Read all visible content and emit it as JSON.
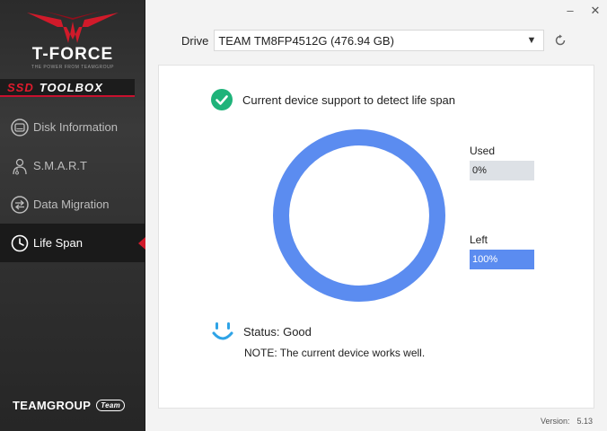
{
  "brand": {
    "title": "T-FORCE",
    "tagline": "THE POWER FROM TEAMGROUP",
    "toolbox_prefix": "SSD",
    "toolbox_suffix": "TOOLBOX",
    "footer_logo": "TEAMGROUP",
    "footer_badge": "Team"
  },
  "sidebar": {
    "items": [
      {
        "label": "Disk Information",
        "icon": "disk-icon",
        "active": false
      },
      {
        "label": "S.M.A.R.T",
        "icon": "doctor-icon",
        "active": false
      },
      {
        "label": "Data Migration",
        "icon": "migration-icon",
        "active": false
      },
      {
        "label": "Life Span",
        "icon": "clock-icon",
        "active": true
      }
    ]
  },
  "window": {
    "minimize": "–",
    "close": "✕"
  },
  "drive": {
    "label": "Drive",
    "selected": "TEAM TM8FP4512G (476.94 GB)"
  },
  "life_span": {
    "support_text": "Current device support to detect life span",
    "used_label": "Used",
    "used_value": "0%",
    "left_label": "Left",
    "left_value": "100%",
    "left_fraction": 1.0,
    "status_text": "Status: Good",
    "note_text": "NOTE: The current device works well."
  },
  "colors": {
    "accent_red": "#d11a2a",
    "ring_blue": "#5b8cf0",
    "check_green": "#1fb37a",
    "smiley_blue": "#2ea3e6"
  },
  "footer": {
    "version_label": "Version:",
    "version_value": "5.13"
  }
}
